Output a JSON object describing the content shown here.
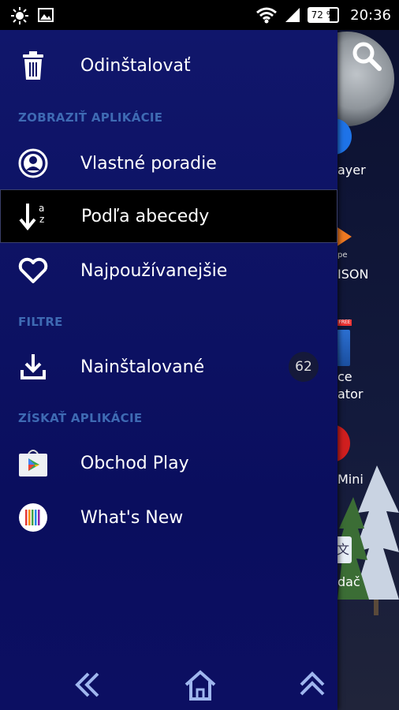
{
  "status_bar": {
    "battery": "72 %",
    "time": "20:36"
  },
  "background": {
    "labels": [
      "ayer",
      "pe",
      "ISON",
      "ce",
      "ator",
      "Mini",
      "dač"
    ]
  },
  "drawer": {
    "uninstall": "Odinštalovať",
    "section_view": "ZOBRAZIŤ APLIKÁCIE",
    "custom_order": "Vlastné poradie",
    "alphabetical": "Podľa abecedy",
    "most_used": "Najpoužívanejšie",
    "section_filters": "FILTRE",
    "installed": "Nainštalované",
    "installed_count": "62",
    "section_get": "ZÍSKAŤ APLIKÁCIE",
    "play_store": "Obchod Play",
    "whats_new": "What's New",
    "sort_icon_letters": "a z"
  },
  "colors": {
    "drawer_bg": "#0d1263",
    "section_header": "#3e6ab3",
    "selected_bg": "#000000"
  }
}
